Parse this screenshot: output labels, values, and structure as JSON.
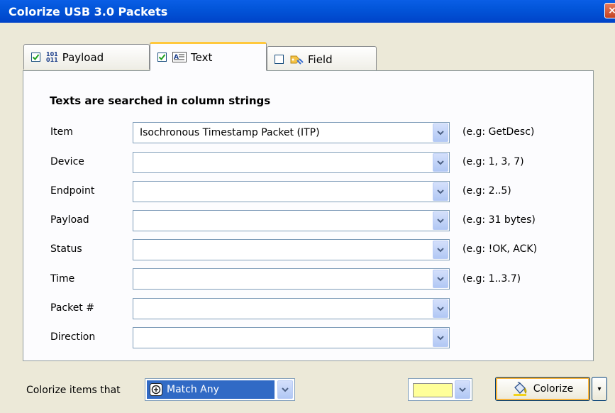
{
  "window": {
    "title": "Colorize USB 3.0 Packets",
    "close_glyph": "×"
  },
  "tabs": [
    {
      "label": "Payload",
      "checked": true,
      "icon": "binary-icon",
      "icon_text_top": "101",
      "icon_text_bottom": "011"
    },
    {
      "label": "Text",
      "checked": true,
      "active": true,
      "icon": "text-field-icon"
    },
    {
      "label": "Field",
      "checked": false,
      "icon": "field-tag-icon"
    }
  ],
  "panel": {
    "heading": "Texts are searched in column strings",
    "rows": [
      {
        "label": "Item",
        "value": "Isochronous Timestamp Packet (ITP)",
        "hint": "(e.g: GetDesc)"
      },
      {
        "label": "Device",
        "value": "",
        "hint": "(e.g: 1, 3, 7)"
      },
      {
        "label": "Endpoint",
        "value": "",
        "hint": "(e.g: 2..5)"
      },
      {
        "label": "Payload",
        "value": "",
        "hint": "(e.g: 31 bytes)"
      },
      {
        "label": "Status",
        "value": "",
        "hint": "(e.g: !OK, ACK)"
      },
      {
        "label": "Time",
        "value": "",
        "hint": "(e.g: 1..3.7)"
      },
      {
        "label": "Packet #",
        "value": "",
        "hint": ""
      },
      {
        "label": "Direction",
        "value": "",
        "hint": ""
      }
    ]
  },
  "footer": {
    "label": "Colorize items that",
    "match_value": "Match Any",
    "match_icon": "match-any-icon",
    "color_value": "#ffff99",
    "colorize_label": "Colorize",
    "colorize_icon": "paint-bucket-icon",
    "menu_glyph": "▾"
  },
  "colors": {
    "titlebar": "#0255d9",
    "selection": "#316ac5",
    "active_tab_accent": "#ffc83c"
  }
}
